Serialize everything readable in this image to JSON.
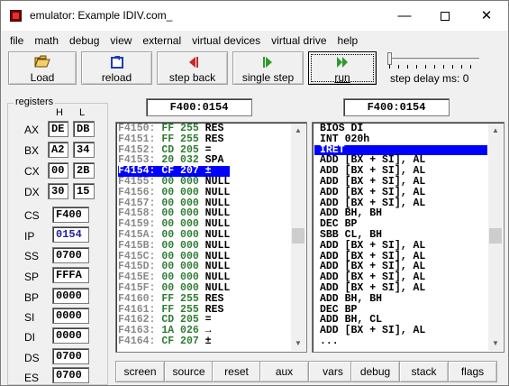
{
  "window": {
    "title": "emulator: Example IDIV.com_",
    "min_glyph": "—",
    "close_glyph": "✕"
  },
  "menu": [
    "file",
    "math",
    "debug",
    "view",
    "external",
    "virtual devices",
    "virtual drive",
    "help"
  ],
  "toolbar": {
    "load": "Load",
    "reload": "reload",
    "step_back": "step back",
    "single_step": "single step",
    "run": "run",
    "step_delay": "step delay ms: 0",
    "step_delay_value": 0
  },
  "registers": {
    "legend": "registers",
    "h_label": "H",
    "l_label": "L",
    "AX": {
      "name": "AX",
      "h": "DE",
      "l": "DB"
    },
    "BX": {
      "name": "BX",
      "h": "A2",
      "l": "34"
    },
    "CX": {
      "name": "CX",
      "h": "00",
      "l": "2B"
    },
    "DX": {
      "name": "DX",
      "h": "30",
      "l": "15"
    },
    "CS": {
      "name": "CS",
      "value": "F400"
    },
    "IP": {
      "name": "IP",
      "value": "0154"
    },
    "SS": {
      "name": "SS",
      "value": "0700"
    },
    "SP": {
      "name": "SP",
      "value": "FFFA"
    },
    "BP": {
      "name": "BP",
      "value": "0000"
    },
    "SI": {
      "name": "SI",
      "value": "0000"
    },
    "DI": {
      "name": "DI",
      "value": "0000"
    },
    "DS": {
      "name": "DS",
      "value": "0700"
    },
    "ES": {
      "name": "ES",
      "value": "0700"
    }
  },
  "memory": {
    "address": "F400:0154",
    "selected_index": 4,
    "lines": [
      {
        "addr": "F4150:",
        "hex": "FF",
        "dec": "255",
        "chr": "RES"
      },
      {
        "addr": "F4151:",
        "hex": "FF",
        "dec": "255",
        "chr": "RES"
      },
      {
        "addr": "F4152:",
        "hex": "CD",
        "dec": "205",
        "chr": "="
      },
      {
        "addr": "F4153:",
        "hex": "20",
        "dec": "032",
        "chr": "SPA"
      },
      {
        "addr": "F4154:",
        "hex": "CF",
        "dec": "207",
        "chr": "±"
      },
      {
        "addr": "F4155:",
        "hex": "00",
        "dec": "000",
        "chr": "NULL"
      },
      {
        "addr": "F4156:",
        "hex": "00",
        "dec": "000",
        "chr": "NULL"
      },
      {
        "addr": "F4157:",
        "hex": "00",
        "dec": "000",
        "chr": "NULL"
      },
      {
        "addr": "F4158:",
        "hex": "00",
        "dec": "000",
        "chr": "NULL"
      },
      {
        "addr": "F4159:",
        "hex": "00",
        "dec": "000",
        "chr": "NULL"
      },
      {
        "addr": "F415A:",
        "hex": "00",
        "dec": "000",
        "chr": "NULL"
      },
      {
        "addr": "F415B:",
        "hex": "00",
        "dec": "000",
        "chr": "NULL"
      },
      {
        "addr": "F415C:",
        "hex": "00",
        "dec": "000",
        "chr": "NULL"
      },
      {
        "addr": "F415D:",
        "hex": "00",
        "dec": "000",
        "chr": "NULL"
      },
      {
        "addr": "F415E:",
        "hex": "00",
        "dec": "000",
        "chr": "NULL"
      },
      {
        "addr": "F415F:",
        "hex": "00",
        "dec": "000",
        "chr": "NULL"
      },
      {
        "addr": "F4160:",
        "hex": "FF",
        "dec": "255",
        "chr": "RES"
      },
      {
        "addr": "F4161:",
        "hex": "FF",
        "dec": "255",
        "chr": "RES"
      },
      {
        "addr": "F4162:",
        "hex": "CD",
        "dec": "205",
        "chr": "="
      },
      {
        "addr": "F4163:",
        "hex": "1A",
        "dec": "026",
        "chr": "→"
      },
      {
        "addr": "F4164:",
        "hex": "CF",
        "dec": "207",
        "chr": "±"
      }
    ]
  },
  "disasm": {
    "address": "F400:0154",
    "selected_index": 2,
    "lines": [
      "BIOS DI",
      "INT 020h",
      "IRET",
      "ADD [BX + SI], AL",
      "ADD [BX + SI], AL",
      "ADD [BX + SI], AL",
      "ADD [BX + SI], AL",
      "ADD [BX + SI], AL",
      "ADD BH, BH",
      "DEC BP",
      "SBB CL, BH",
      "ADD [BX + SI], AL",
      "ADD [BX + SI], AL",
      "ADD [BX + SI], AL",
      "ADD [BX + SI], AL",
      "ADD [BX + SI], AL",
      "ADD BH, BH",
      "DEC BP",
      "ADD BH, CL",
      "ADD [BX + SI], AL",
      "..."
    ]
  },
  "bottom_buttons": [
    "screen",
    "source",
    "reset",
    "aux",
    "vars",
    "debug",
    "stack",
    "flags"
  ]
}
